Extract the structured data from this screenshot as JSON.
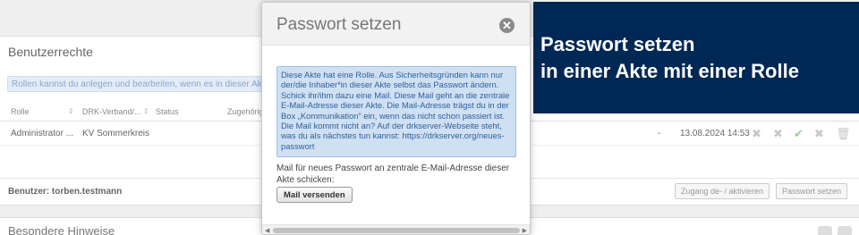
{
  "background": {
    "rights_panel": {
      "heading": "Benutzerrechte",
      "info_text": "Rollen kannst du anlegen und bearbeiten, wenn es in dieser Akte e",
      "columns": [
        "Rolle",
        "DRK-Verband/...",
        "Status",
        "Zugehörig"
      ],
      "row": {
        "role": "Administrator ...",
        "verband": "KV Sommerkreis",
        "dash": "-",
        "date": "13.08.2024 14:53"
      },
      "footer_user": "Benutzer: torben.testmann",
      "btn_access": "Zugang de- / aktivieren",
      "btn_password": "Passwort setzen"
    },
    "notes_panel": {
      "heading": "Besondere Hinweise"
    }
  },
  "modal": {
    "title": "Passwort setzen",
    "close_icon": "close-circle-icon",
    "notice": "Diese Akte hat eine Rolle. Aus Sicherheitsgründen kann nur der/die Inhaber*in dieser Akte selbst das Passwort ändern. Schick ihr/ihm dazu eine Mail. Diese Mail geht an die zentrale E-Mail-Adresse dieser Akte. Die Mail-Adresse trägst du in der Box „Kommunikation“ ein, wenn das nicht schon passiert ist. Die Mail kommt nicht an? Auf der drkserver-Webseite steht, was du als nächstes tun kannst: https://drkserver.org/neues-passwort",
    "send_label": "Mail für neues Passwort an zentrale E-Mail-Adresse dieser Akte schicken:",
    "send_button": "Mail versenden"
  },
  "caption": {
    "line1": "Passwort setzen",
    "line2": "in einer Akte mit einer Rolle"
  },
  "colors": {
    "caption_bg": "#002855",
    "notice_bg": "#cfe0f3",
    "notice_text": "#2f5f9a"
  }
}
